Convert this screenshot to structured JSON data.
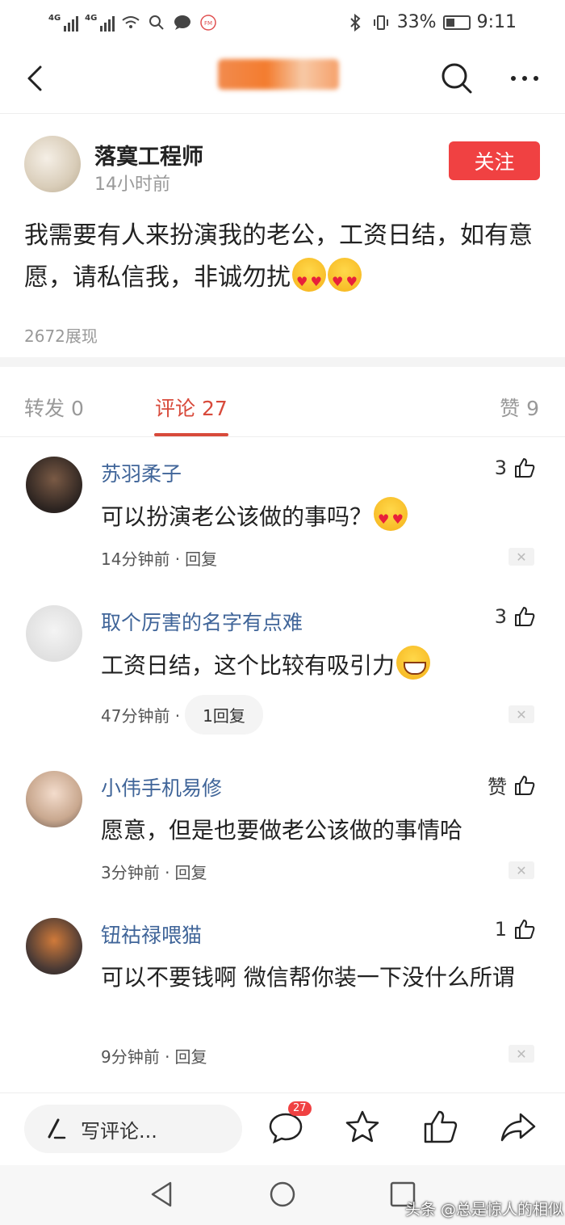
{
  "status_bar": {
    "network_1": "4G",
    "network_2": "4G",
    "battery_pct": "33%",
    "time": "9:11",
    "icons": [
      "signal-icon",
      "wifi-icon",
      "search-icon",
      "message-icon",
      "fm-icon",
      "bluetooth-icon",
      "vibrate-icon",
      "battery-icon"
    ]
  },
  "nav": {
    "icons": [
      "back-icon",
      "search-icon",
      "more-icon"
    ]
  },
  "post": {
    "author": "落寞工程师",
    "time": "14小时前",
    "follow_label": "关注",
    "text": "我需要有人来扮演我的老公，工资日结，如有意愿，请私信我，非诚勿扰",
    "views": "2672展现"
  },
  "tabs": {
    "forward": "转发 0",
    "comments": "评论 27",
    "likes": "赞 9"
  },
  "comments": [
    {
      "user": "苏羽柔子",
      "text": "可以扮演老公该做的事吗？",
      "time": "14分钟前 ·",
      "reply": "回复",
      "likes": "3"
    },
    {
      "user": "取个厉害的名字有点难",
      "text": "工资日结，这个比较有吸引力",
      "time": "47分钟前 ·",
      "reply": "1回复",
      "likes": "3"
    },
    {
      "user": "小伟手机易修",
      "text": "愿意，但是也要做老公该做的事情哈",
      "time": "3分钟前 ·",
      "reply": "回复",
      "likes": "赞"
    },
    {
      "user": "钮祜禄喂猫",
      "text": "可以不要钱啊 微信帮你装一下没什么所谓",
      "time": "9分钟前 ·",
      "reply": "回复",
      "likes": "1"
    }
  ],
  "bottom_bar": {
    "write_placeholder": "写评论...",
    "comment_badge": "27"
  },
  "watermark": "头条 @总是惊人的相似",
  "colors": {
    "accent": "#f04142",
    "tab_active": "#d84a3b",
    "username": "#406599"
  }
}
